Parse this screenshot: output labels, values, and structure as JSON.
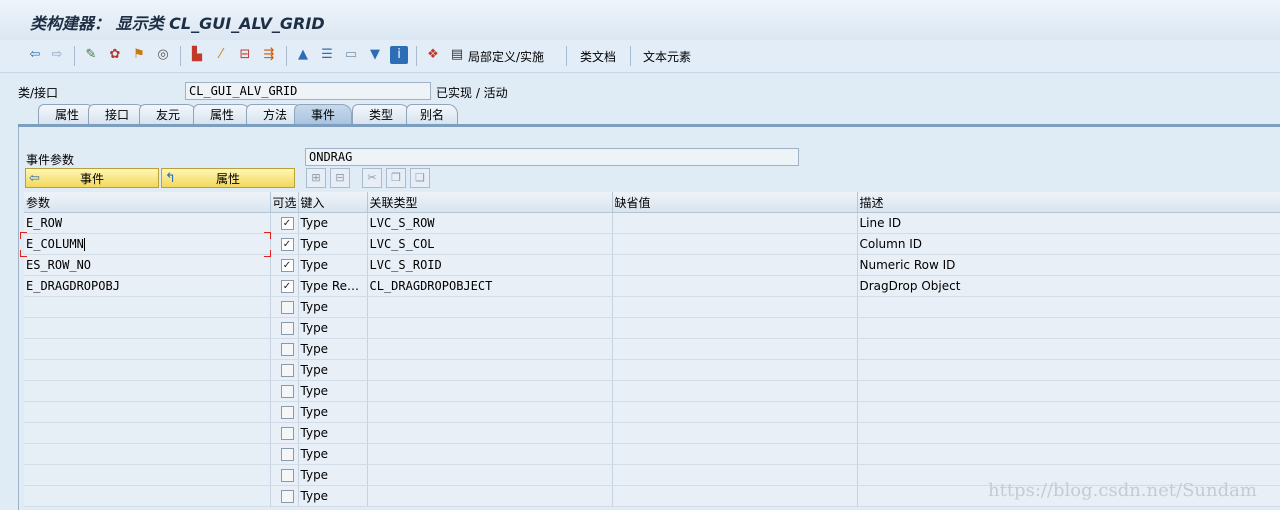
{
  "window": {
    "title": "类构建器： 显示类 CL_GUI_ALV_GRID"
  },
  "toolbar": {
    "icons": [
      "back-arrow-icon",
      "forward-arrow-icon",
      "display-change-icon",
      "other-object-icon",
      "activate-icon",
      "where-used-icon",
      "object-list-icon",
      "wand-icon",
      "navigate-icon",
      "display-object-list-icon",
      "hierarchy-icon",
      "enhance-icon",
      "layout-icon",
      "filter-icon",
      "info-icon",
      "class-hierarchy-icon",
      "local-def-icon"
    ],
    "local_def_label": "局部定义/实施",
    "class_doc_label": "类文档",
    "text_elements_label": "文本元素"
  },
  "header": {
    "class_label": "类/接口",
    "class_value": "CL_GUI_ALV_GRID",
    "status": "已实现 / 活动"
  },
  "tabs": [
    {
      "label": "属性",
      "active": false
    },
    {
      "label": "接口",
      "active": false
    },
    {
      "label": "友元",
      "active": false
    },
    {
      "label": "属性",
      "active": false
    },
    {
      "label": "方法",
      "active": false
    },
    {
      "label": "事件",
      "active": true
    },
    {
      "label": "类型",
      "active": false
    },
    {
      "label": "别名",
      "active": false
    }
  ],
  "event_params": {
    "label": "事件参数",
    "value": "ONDRAG",
    "event_button": "事件",
    "attribute_button": "属性"
  },
  "grid": {
    "columns": [
      "参数",
      "可选",
      "键入",
      "关联类型",
      "缺省值",
      "描述"
    ],
    "rows": [
      {
        "param": "E_ROW",
        "optional": true,
        "typing": "Type",
        "assoc_type": "LVC_S_ROW",
        "default": "",
        "desc": "Line ID"
      },
      {
        "param": "E_COLUMN",
        "optional": true,
        "typing": "Type",
        "assoc_type": "LVC_S_COL",
        "default": "",
        "desc": "Column ID"
      },
      {
        "param": "ES_ROW_NO",
        "optional": true,
        "typing": "Type",
        "assoc_type": "LVC_S_ROID",
        "default": "",
        "desc": "Numeric Row ID"
      },
      {
        "param": "E_DRAGDROPOBJ",
        "optional": true,
        "typing": "Type Re…",
        "assoc_type": "CL_DRAGDROPOBJECT",
        "default": "",
        "desc": "DragDrop Object"
      },
      {
        "param": "",
        "optional": false,
        "typing": "Type",
        "assoc_type": "",
        "default": "",
        "desc": ""
      },
      {
        "param": "",
        "optional": false,
        "typing": "Type",
        "assoc_type": "",
        "default": "",
        "desc": ""
      },
      {
        "param": "",
        "optional": false,
        "typing": "Type",
        "assoc_type": "",
        "default": "",
        "desc": ""
      },
      {
        "param": "",
        "optional": false,
        "typing": "Type",
        "assoc_type": "",
        "default": "",
        "desc": ""
      },
      {
        "param": "",
        "optional": false,
        "typing": "Type",
        "assoc_type": "",
        "default": "",
        "desc": ""
      },
      {
        "param": "",
        "optional": false,
        "typing": "Type",
        "assoc_type": "",
        "default": "",
        "desc": ""
      },
      {
        "param": "",
        "optional": false,
        "typing": "Type",
        "assoc_type": "",
        "default": "",
        "desc": ""
      },
      {
        "param": "",
        "optional": false,
        "typing": "Type",
        "assoc_type": "",
        "default": "",
        "desc": ""
      },
      {
        "param": "",
        "optional": false,
        "typing": "Type",
        "assoc_type": "",
        "default": "",
        "desc": ""
      },
      {
        "param": "",
        "optional": false,
        "typing": "Type",
        "assoc_type": "",
        "default": "",
        "desc": ""
      }
    ]
  },
  "watermark": "https://blog.csdn.net/Sundam"
}
